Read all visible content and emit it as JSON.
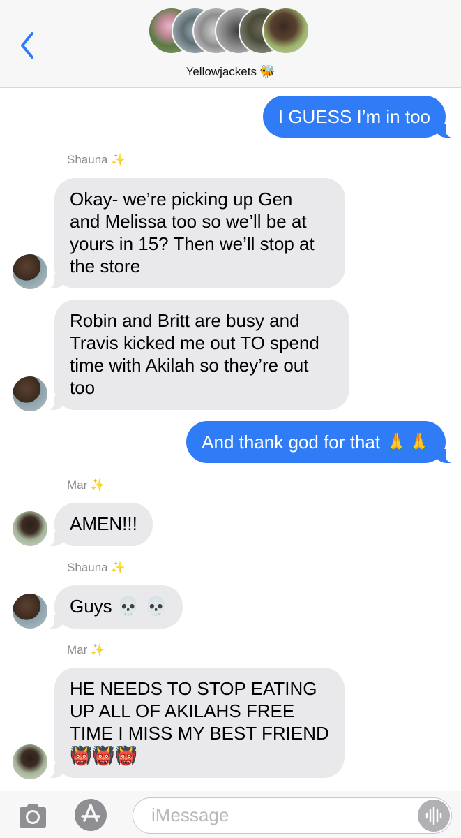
{
  "header": {
    "group_name": "Yellowjackets",
    "group_emoji": "🐝"
  },
  "messages": [
    {
      "type": "outgoing",
      "text": "I GUESS I’m in too"
    },
    {
      "type": "sender",
      "text": "Shauna",
      "emoji": "✨"
    },
    {
      "type": "incoming",
      "text": "Okay- we’re picking up Gen\nand Melissa too so we’ll be at\nyours in 15? Then we’ll stop at\nthe store"
    },
    {
      "type": "incoming",
      "text": "Robin and Britt are busy and\nTravis kicked me out TO spend\ntime with Akilah so they’re out\ntoo"
    },
    {
      "type": "outgoing",
      "text": "And thank god for that 🙏🙏"
    },
    {
      "type": "sender",
      "text": "Mar",
      "emoji": "✨"
    },
    {
      "type": "incoming",
      "text": "AMEN!!!"
    },
    {
      "type": "sender",
      "text": "Shauna",
      "emoji": "✨"
    },
    {
      "type": "incoming",
      "text": "Guys 💀 💀"
    },
    {
      "type": "sender",
      "text": "Mar",
      "emoji": "✨"
    },
    {
      "type": "incoming",
      "text": "HE NEEDS TO STOP EATING\nUP ALL OF AKILAHS FREE\nTIME I MISS MY BEST FRIEND\n👹👹👹"
    }
  ],
  "input": {
    "placeholder": "iMessage"
  },
  "colors": {
    "outgoing_bubble": "#2f7cf6",
    "incoming_bubble": "#e9e9eb",
    "back_chevron": "#2f7cf6"
  },
  "icons": [
    "back-chevron-icon",
    "camera-icon",
    "app-store-icon",
    "audio-waveform-icon"
  ]
}
